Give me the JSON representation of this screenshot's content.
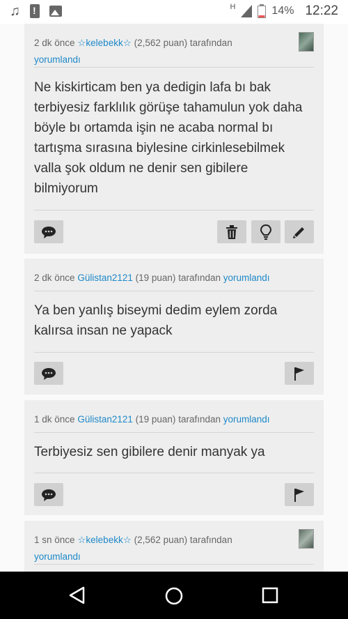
{
  "status_bar": {
    "icons_left": [
      "music-icon",
      "warning-icon",
      "image-icon"
    ],
    "network": "H",
    "battery": "14%",
    "time": "12:22"
  },
  "comments": [
    {
      "time": "2 dk önce",
      "user": "☆kelebekk☆",
      "points": "(2,562 puan)",
      "by": "tarafından",
      "action": "yorumlandı",
      "text": "Ne kiskirticam ben ya dedigin lafa bı bak terbiyesiz farklılık görüşe tahamulun yok daha böyle bı ortamda işin ne acaba normal bı tartışma sırasına biylesine cirkinlesebilmek valla şok oldum ne denir sen gibilere bilmiyorum",
      "buttons_right": [
        "delete",
        "hint",
        "edit"
      ]
    },
    {
      "time": "2 dk önce",
      "user": "Gülistan2121",
      "points": "(19 puan)",
      "by": "tarafından",
      "action": "yorumlandı",
      "text": "Ya ben yanlış biseymi dedim eylem zorda kalırsa insan ne yapack",
      "buttons_right": [
        "flag"
      ]
    },
    {
      "time": "1 dk önce",
      "user": "Gülistan2121",
      "points": "(19 puan)",
      "by": "tarafından",
      "action": "yorumlandı",
      "text": "Terbiyesiz sen gibilere denir manyak ya",
      "buttons_right": [
        "flag"
      ]
    },
    {
      "time": "1 sn önce",
      "user": "☆kelebekk☆",
      "points": "(2,562 puan)",
      "by": "tarafından",
      "action": "yorumlandı"
    }
  ],
  "colors": {
    "link": "#1e88c8",
    "card_bg": "#eeeeee",
    "button_bg": "#d0d0d0",
    "navbar": "#000000"
  },
  "nav": [
    "back",
    "home",
    "recents"
  ]
}
